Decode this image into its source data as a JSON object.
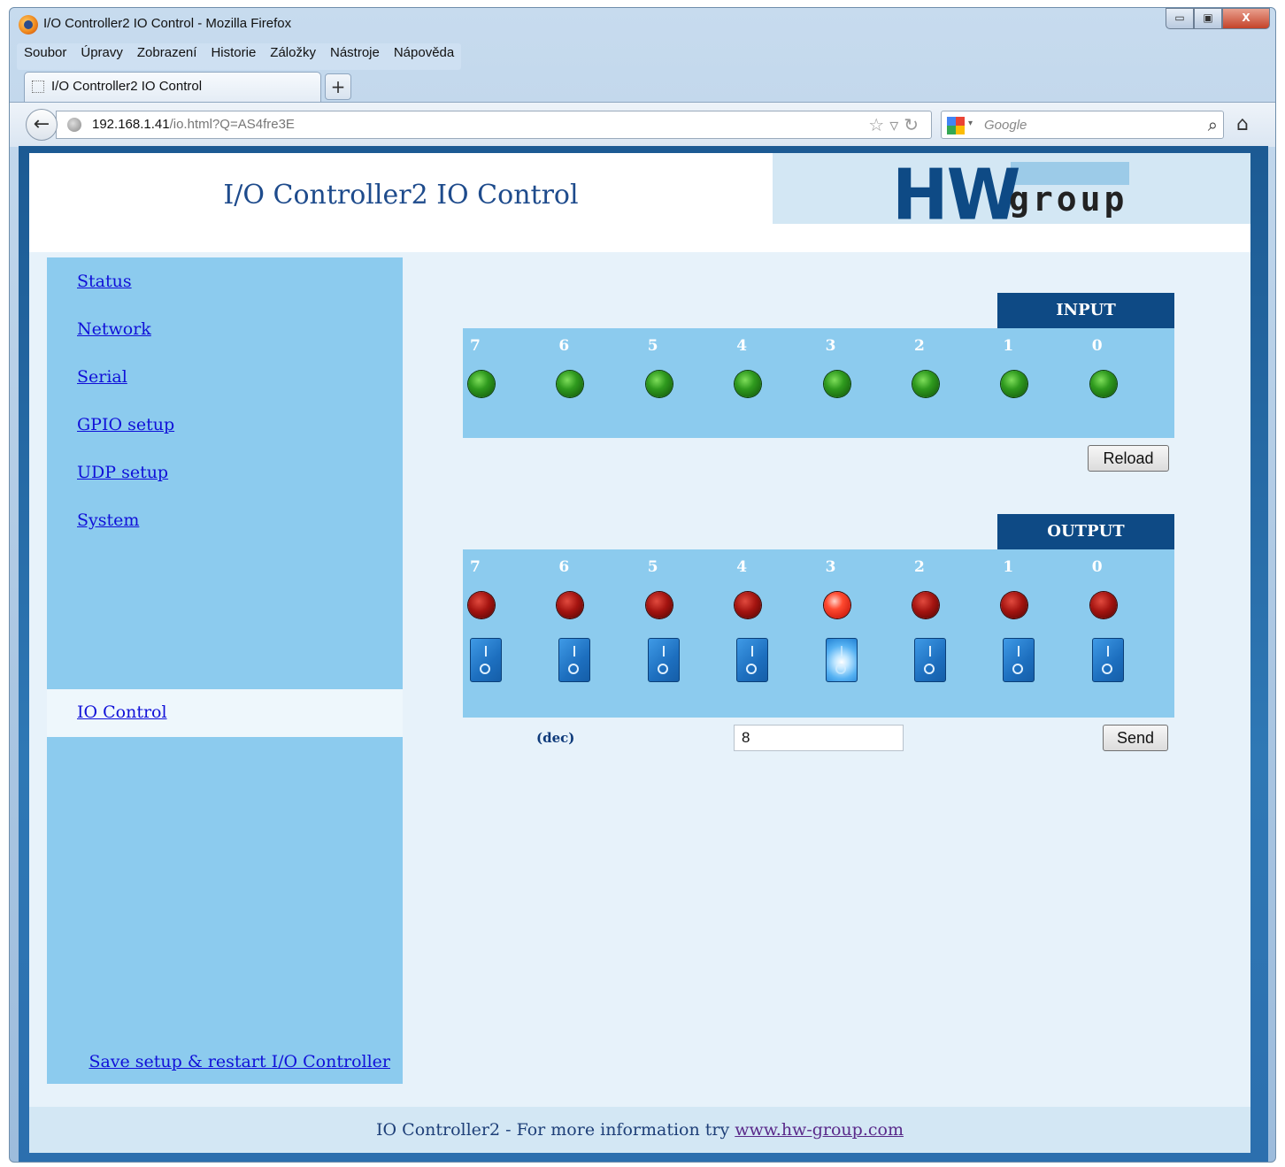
{
  "window": {
    "title": "I/O Controller2 IO Control - Mozilla Firefox",
    "buttons": [
      "▭",
      "▣",
      "X"
    ]
  },
  "menu": [
    "Soubor",
    "Úpravy",
    "Zobrazení",
    "Historie",
    "Záložky",
    "Nástroje",
    "Nápověda"
  ],
  "tab": {
    "label": "I/O Controller2 IO Control",
    "new_tab": "+"
  },
  "address": {
    "host": "192.168.1.41",
    "path": "/io.html?Q=AS4fre3E",
    "search_placeholder": "Google"
  },
  "page": {
    "title": "I/O Controller2 IO Control",
    "logo": {
      "hw": "HW",
      "group": "group"
    },
    "nav": [
      "Status",
      "Network",
      "Serial",
      "GPIO setup",
      "UDP setup",
      "System"
    ],
    "nav_active": "IO Control",
    "save_link": "Save setup & restart I/O Controller",
    "input": {
      "heading": "INPUT",
      "channels": [
        "7",
        "6",
        "5",
        "4",
        "3",
        "2",
        "1",
        "0"
      ],
      "states": [
        1,
        1,
        1,
        1,
        1,
        1,
        1,
        1
      ],
      "reload_label": "Reload"
    },
    "output": {
      "heading": "OUTPUT",
      "channels": [
        "7",
        "6",
        "5",
        "4",
        "3",
        "2",
        "1",
        "0"
      ],
      "states": [
        0,
        0,
        0,
        0,
        1,
        0,
        0,
        0
      ],
      "dec_label": "(dec)",
      "dec_value": "8",
      "send_label": "Send"
    },
    "footer": {
      "text": "IO Controller2 - For more information try ",
      "link": "www.hw-group.com"
    }
  }
}
